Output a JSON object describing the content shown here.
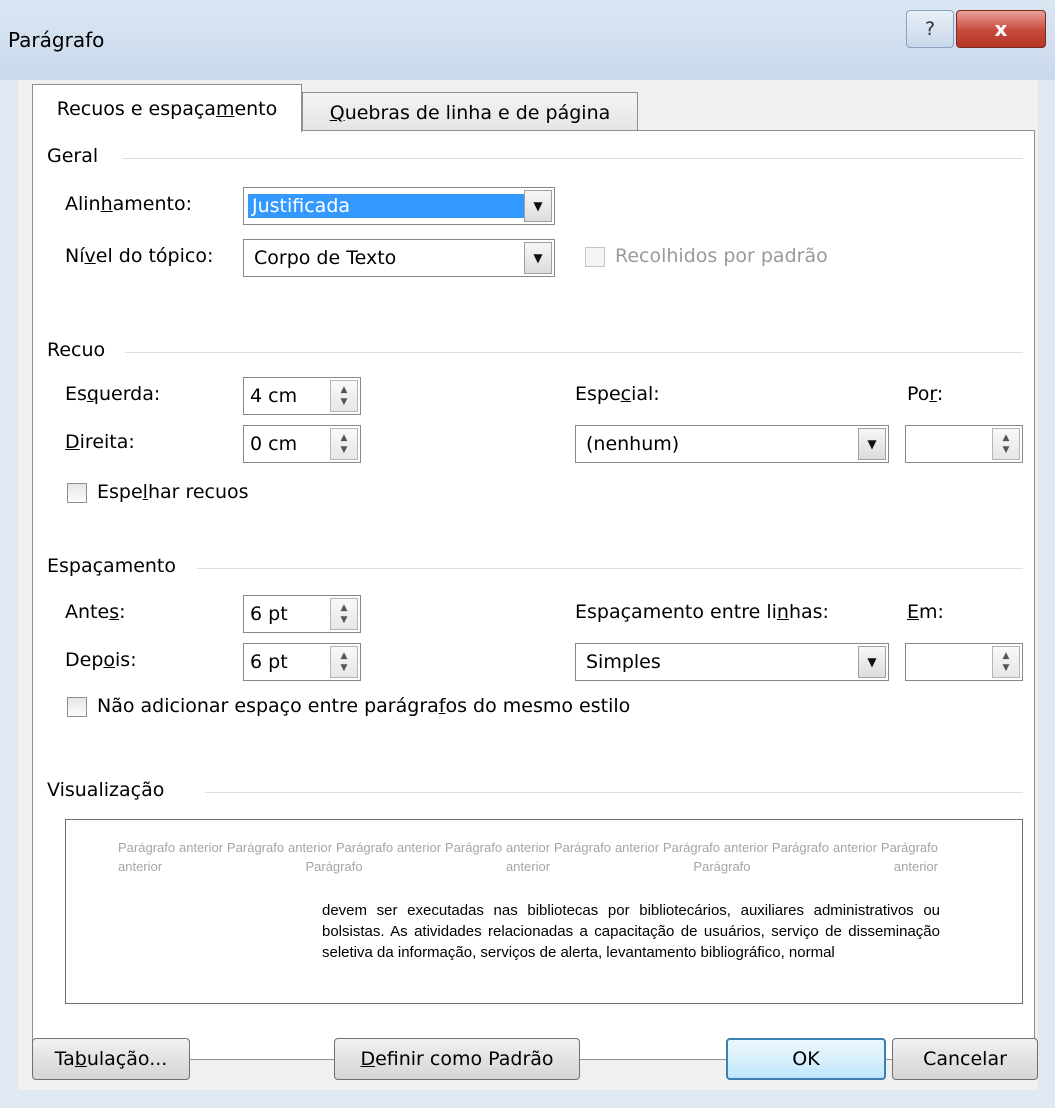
{
  "window": {
    "title": "Parágrafo",
    "help_label": "?",
    "close_label": "x"
  },
  "tabs": [
    {
      "label_pre": "Recuos e espaça",
      "label_u": "m",
      "label_post": "ento"
    },
    {
      "label_pre": "",
      "label_u": "Q",
      "label_post": "uebras de linha e de página"
    }
  ],
  "geral": {
    "heading": "Geral",
    "alinhamento_pre": "Alin",
    "alinhamento_u": "h",
    "alinhamento_post": "amento:",
    "alinhamento_value": "Justificada",
    "nivel_pre": "Ní",
    "nivel_u": "v",
    "nivel_post": "el do tópico:",
    "nivel_value": "Corpo de Texto",
    "recolhidos_label": "Recolhidos por padrão"
  },
  "recuo": {
    "heading": "Recuo",
    "esquerda_pre": "Es",
    "esquerda_u": "q",
    "esquerda_post": "uerda:",
    "esquerda_value": "4 cm",
    "direita_u": "D",
    "direita_post": "ireita:",
    "direita_value": "0 cm",
    "especial_pre": "Espe",
    "especial_u": "c",
    "especial_post": "ial:",
    "especial_value": "(nenhum)",
    "por_pre": "Po",
    "por_u": "r",
    "por_post": ":",
    "por_value": "",
    "espelhar_pre": "Espe",
    "espelhar_u": "l",
    "espelhar_post": "har recuos"
  },
  "espacamento": {
    "heading": "Espaçamento",
    "antes_pre": "Ante",
    "antes_u": "s",
    "antes_post": ":",
    "antes_value": "6 pt",
    "depois_pre": "Dep",
    "depois_u": "o",
    "depois_post": "is:",
    "depois_value": "6 pt",
    "entre_pre": "Espaçamento entre li",
    "entre_u": "n",
    "entre_post": "has:",
    "entre_value": "Simples",
    "em_u": "E",
    "em_post": "m:",
    "em_value": "",
    "nao_adicionar_pre": "Não adicionar espaço entre parágra",
    "nao_adicionar_u": "f",
    "nao_adicionar_post": "os do mesmo estilo"
  },
  "visualizacao": {
    "heading": "Visualização",
    "previous_text": "Parágrafo anterior Parágrafo anterior Parágrafo anterior Parágrafo anterior Parágrafo anterior Parágrafo anterior Parágrafo anterior Parágrafo anterior Parágrafo anterior Parágrafo anterior",
    "current_text": "devem ser executadas nas bibliotecas por bibliotecários, auxiliares administrativos ou bolsistas. As atividades relacionadas a capacitação de usuários, serviço de disseminação seletiva da informação, serviços de alerta, levantamento bibliográfico, normal"
  },
  "buttons": {
    "tabulacao_pre": "Ta",
    "tabulacao_u": "b",
    "tabulacao_post": "ulação...",
    "definir_u": "D",
    "definir_post": "efinir como Padrão",
    "ok": "OK",
    "cancelar": "Cancelar"
  }
}
